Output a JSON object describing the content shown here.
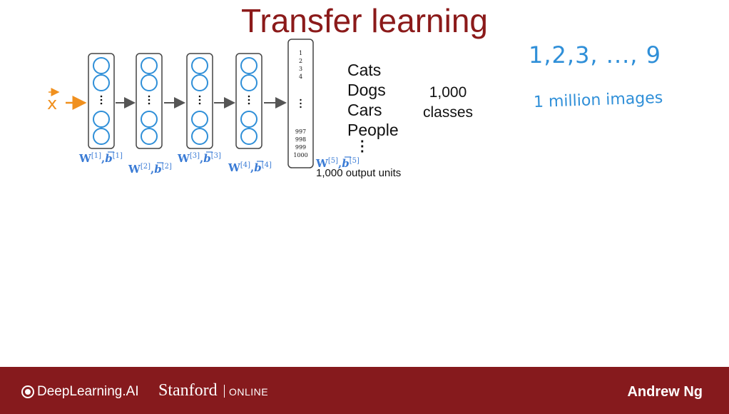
{
  "title": "Transfer learning",
  "input_label": "x",
  "network": {
    "hidden_layers": [
      {
        "w": "W",
        "b": "b",
        "index": "[1]"
      },
      {
        "w": "W",
        "b": "b",
        "index": "[2]"
      },
      {
        "w": "W",
        "b": "b",
        "index": "[3]"
      },
      {
        "w": "W",
        "b": "b",
        "index": "[4]"
      }
    ],
    "output_layer": {
      "w": "W",
      "b": "b",
      "index": "[5]",
      "top_units": [
        "1",
        "2",
        "3",
        "4"
      ],
      "bottom_units": [
        "997",
        "998",
        "999",
        "1000"
      ],
      "caption": "1,000 output units"
    }
  },
  "classes": [
    "Cats",
    "Dogs",
    "Cars",
    "People"
  ],
  "num_classes": [
    "1,000",
    "classes"
  ],
  "handwriting": {
    "digits": "1,2,3, ..., 9",
    "images": "1 million images"
  },
  "colors": {
    "title": "#8b1a1a",
    "input": "#f0901e",
    "neuron": "#2f8fd8",
    "label": "#3a7bd5",
    "footer": "#861a1d"
  },
  "footer": {
    "brand": "DeepLearning.AI",
    "university": "Stanford",
    "online": "ONLINE",
    "presenter": "Andrew Ng"
  }
}
